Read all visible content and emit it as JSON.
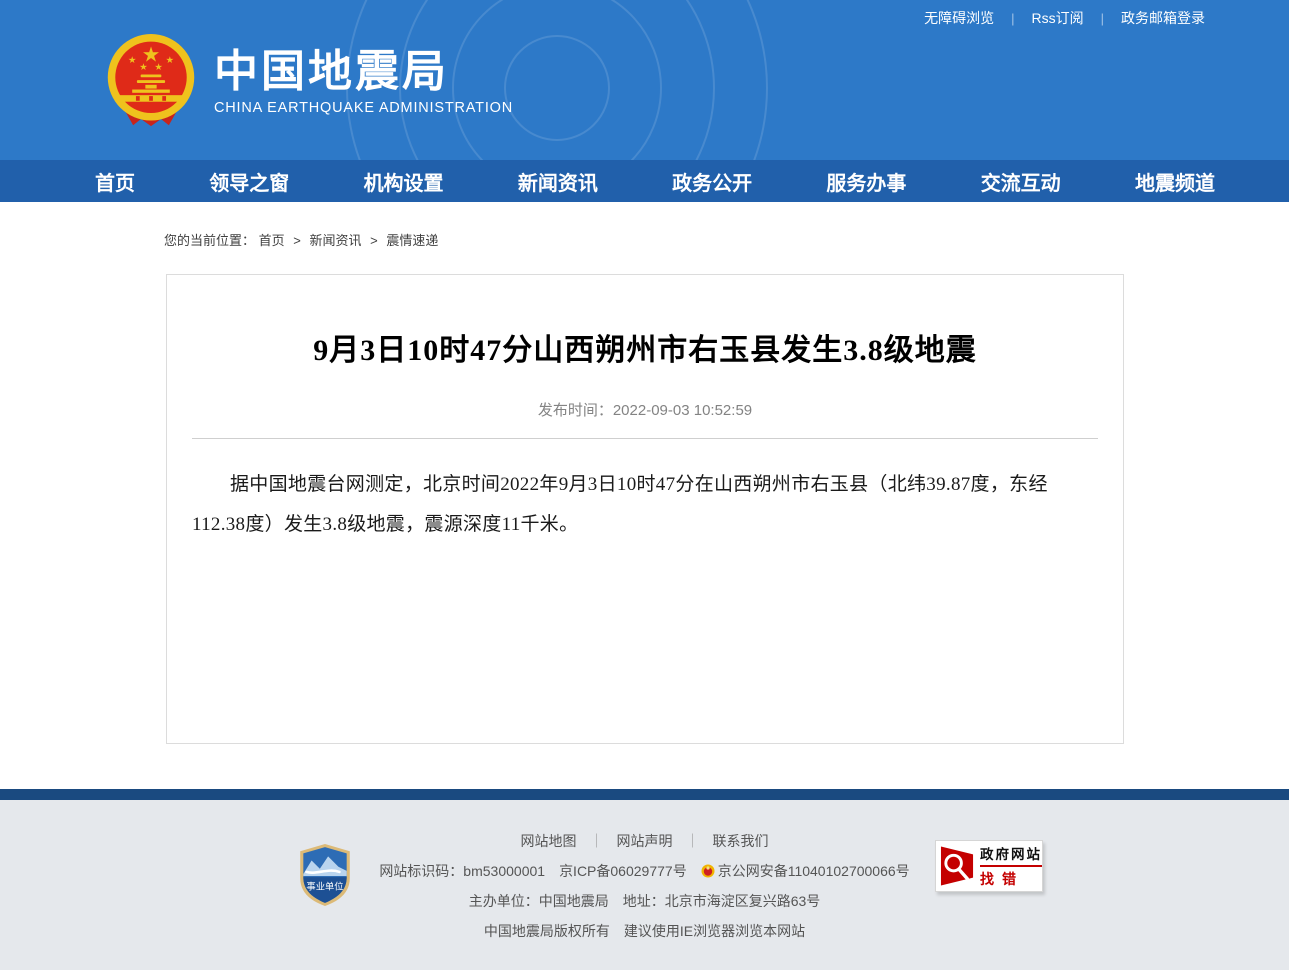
{
  "topbar": {
    "separator": "|",
    "links": [
      "无障碍浏览",
      "Rss订阅",
      "政务邮箱登录"
    ]
  },
  "header": {
    "site_name": "中国地震局",
    "site_name_en": "CHINA EARTHQUAKE ADMINISTRATION"
  },
  "nav": {
    "items": [
      "首页",
      "领导之窗",
      "机构设置",
      "新闻资讯",
      "政务公开",
      "服务办事",
      "交流互动",
      "地震频道"
    ]
  },
  "breadcrumb": {
    "label": "您的当前位置：",
    "separator": ">",
    "items": [
      "首页",
      "新闻资讯",
      "震情速递"
    ]
  },
  "article": {
    "title": "9月3日10时47分山西朔州市右玉县发生3.8级地震",
    "publish_time": "发布时间：2022-09-03 10:52:59",
    "body": "据中国地震台网测定，北京时间2022年9月3日10时47分在山西朔州市右玉县（北纬39.87度，东经112.38度）发生3.8级地震，震源深度11千米。"
  },
  "footer": {
    "separator": "｜",
    "links": [
      "网站地图",
      "网站声明",
      "联系我们"
    ],
    "site_code": "网站标识码：bm53000001",
    "icp": "京ICP备06029777号",
    "police": "京公网安备11040102700066号",
    "organizer": "主办单位：中国地震局",
    "address": "地址：北京市海淀区复兴路63号",
    "copyright": "中国地震局版权所有",
    "browser_note": "建议使用IE浏览器浏览本网站",
    "badge_left_label": "事业单位",
    "badge_right_line1": "政府网站",
    "badge_right_line2": "找错"
  },
  "icons": {
    "national-emblem": "china national emblem",
    "shield-badge": "public institution shield",
    "magnifier": "red magnifier find-error",
    "police-badge": "beijing public security badge"
  },
  "colors": {
    "header_blue": "#2d79c8",
    "nav_blue": "#2160ab",
    "footer_navy": "#1a4a80",
    "footer_bg": "#e5e8ec",
    "accent_red": "#c40000",
    "emblem_gold": "#efc21d",
    "emblem_red": "#df2a18"
  }
}
